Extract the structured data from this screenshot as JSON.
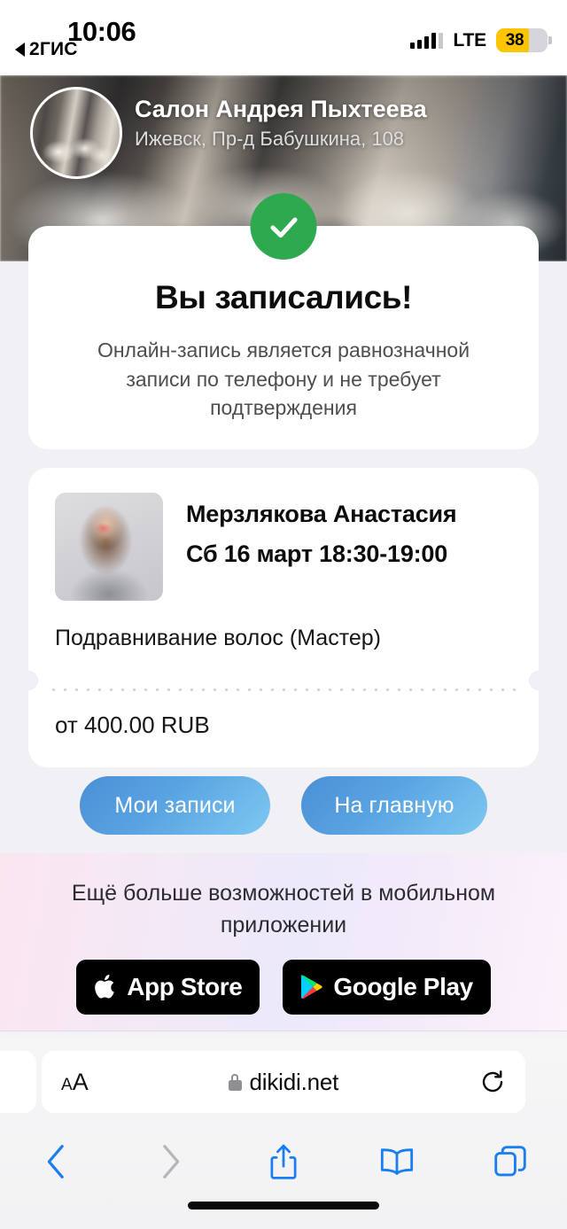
{
  "status_bar": {
    "time": "10:06",
    "back_app_label": "2ГИС",
    "network_label": "LTE",
    "battery_percent": "38",
    "battery_color": "#fdc500"
  },
  "hero": {
    "salon_name": "Салон Андрея Пыхтеева",
    "address": "Ижевск, Пр-д Бабушкина, 108",
    "avatar_icon": "salon-interior-photo"
  },
  "success_card": {
    "status_icon": "check-circle-icon",
    "status_color": "#2fa94f",
    "title": "Вы записались!",
    "description": "Онлайн-запись является равнозначной записи по телефону и не требует подтверждения"
  },
  "ticket": {
    "photo_icon": "master-portrait-photo",
    "master_name": "Мерзлякова Анастасия",
    "datetime": "Сб 16 март 18:30-19:00",
    "service": "Подравнивание волос (Мастер)",
    "price": "от 400.00 RUB"
  },
  "actions": {
    "my_bookings_label": "Мои записи",
    "home_label": "На главную",
    "accent_color": "#5aa4e2"
  },
  "promo": {
    "title": "Ещё больше возможностей в мобильном приложении",
    "app_store_label": "App Store",
    "google_play_label": "Google Play",
    "app_store_icon": "apple-logo-icon",
    "google_play_icon": "google-play-triangle-icon"
  },
  "browser": {
    "text_size_label": "AA",
    "url": "dikidi.net",
    "lock_icon": "lock-icon",
    "reload_icon": "reload-icon",
    "back_icon": "chevron-left-icon",
    "forward_icon": "chevron-right-icon",
    "share_icon": "share-icon",
    "bookmarks_icon": "book-icon",
    "tabs_icon": "tabs-icon"
  }
}
